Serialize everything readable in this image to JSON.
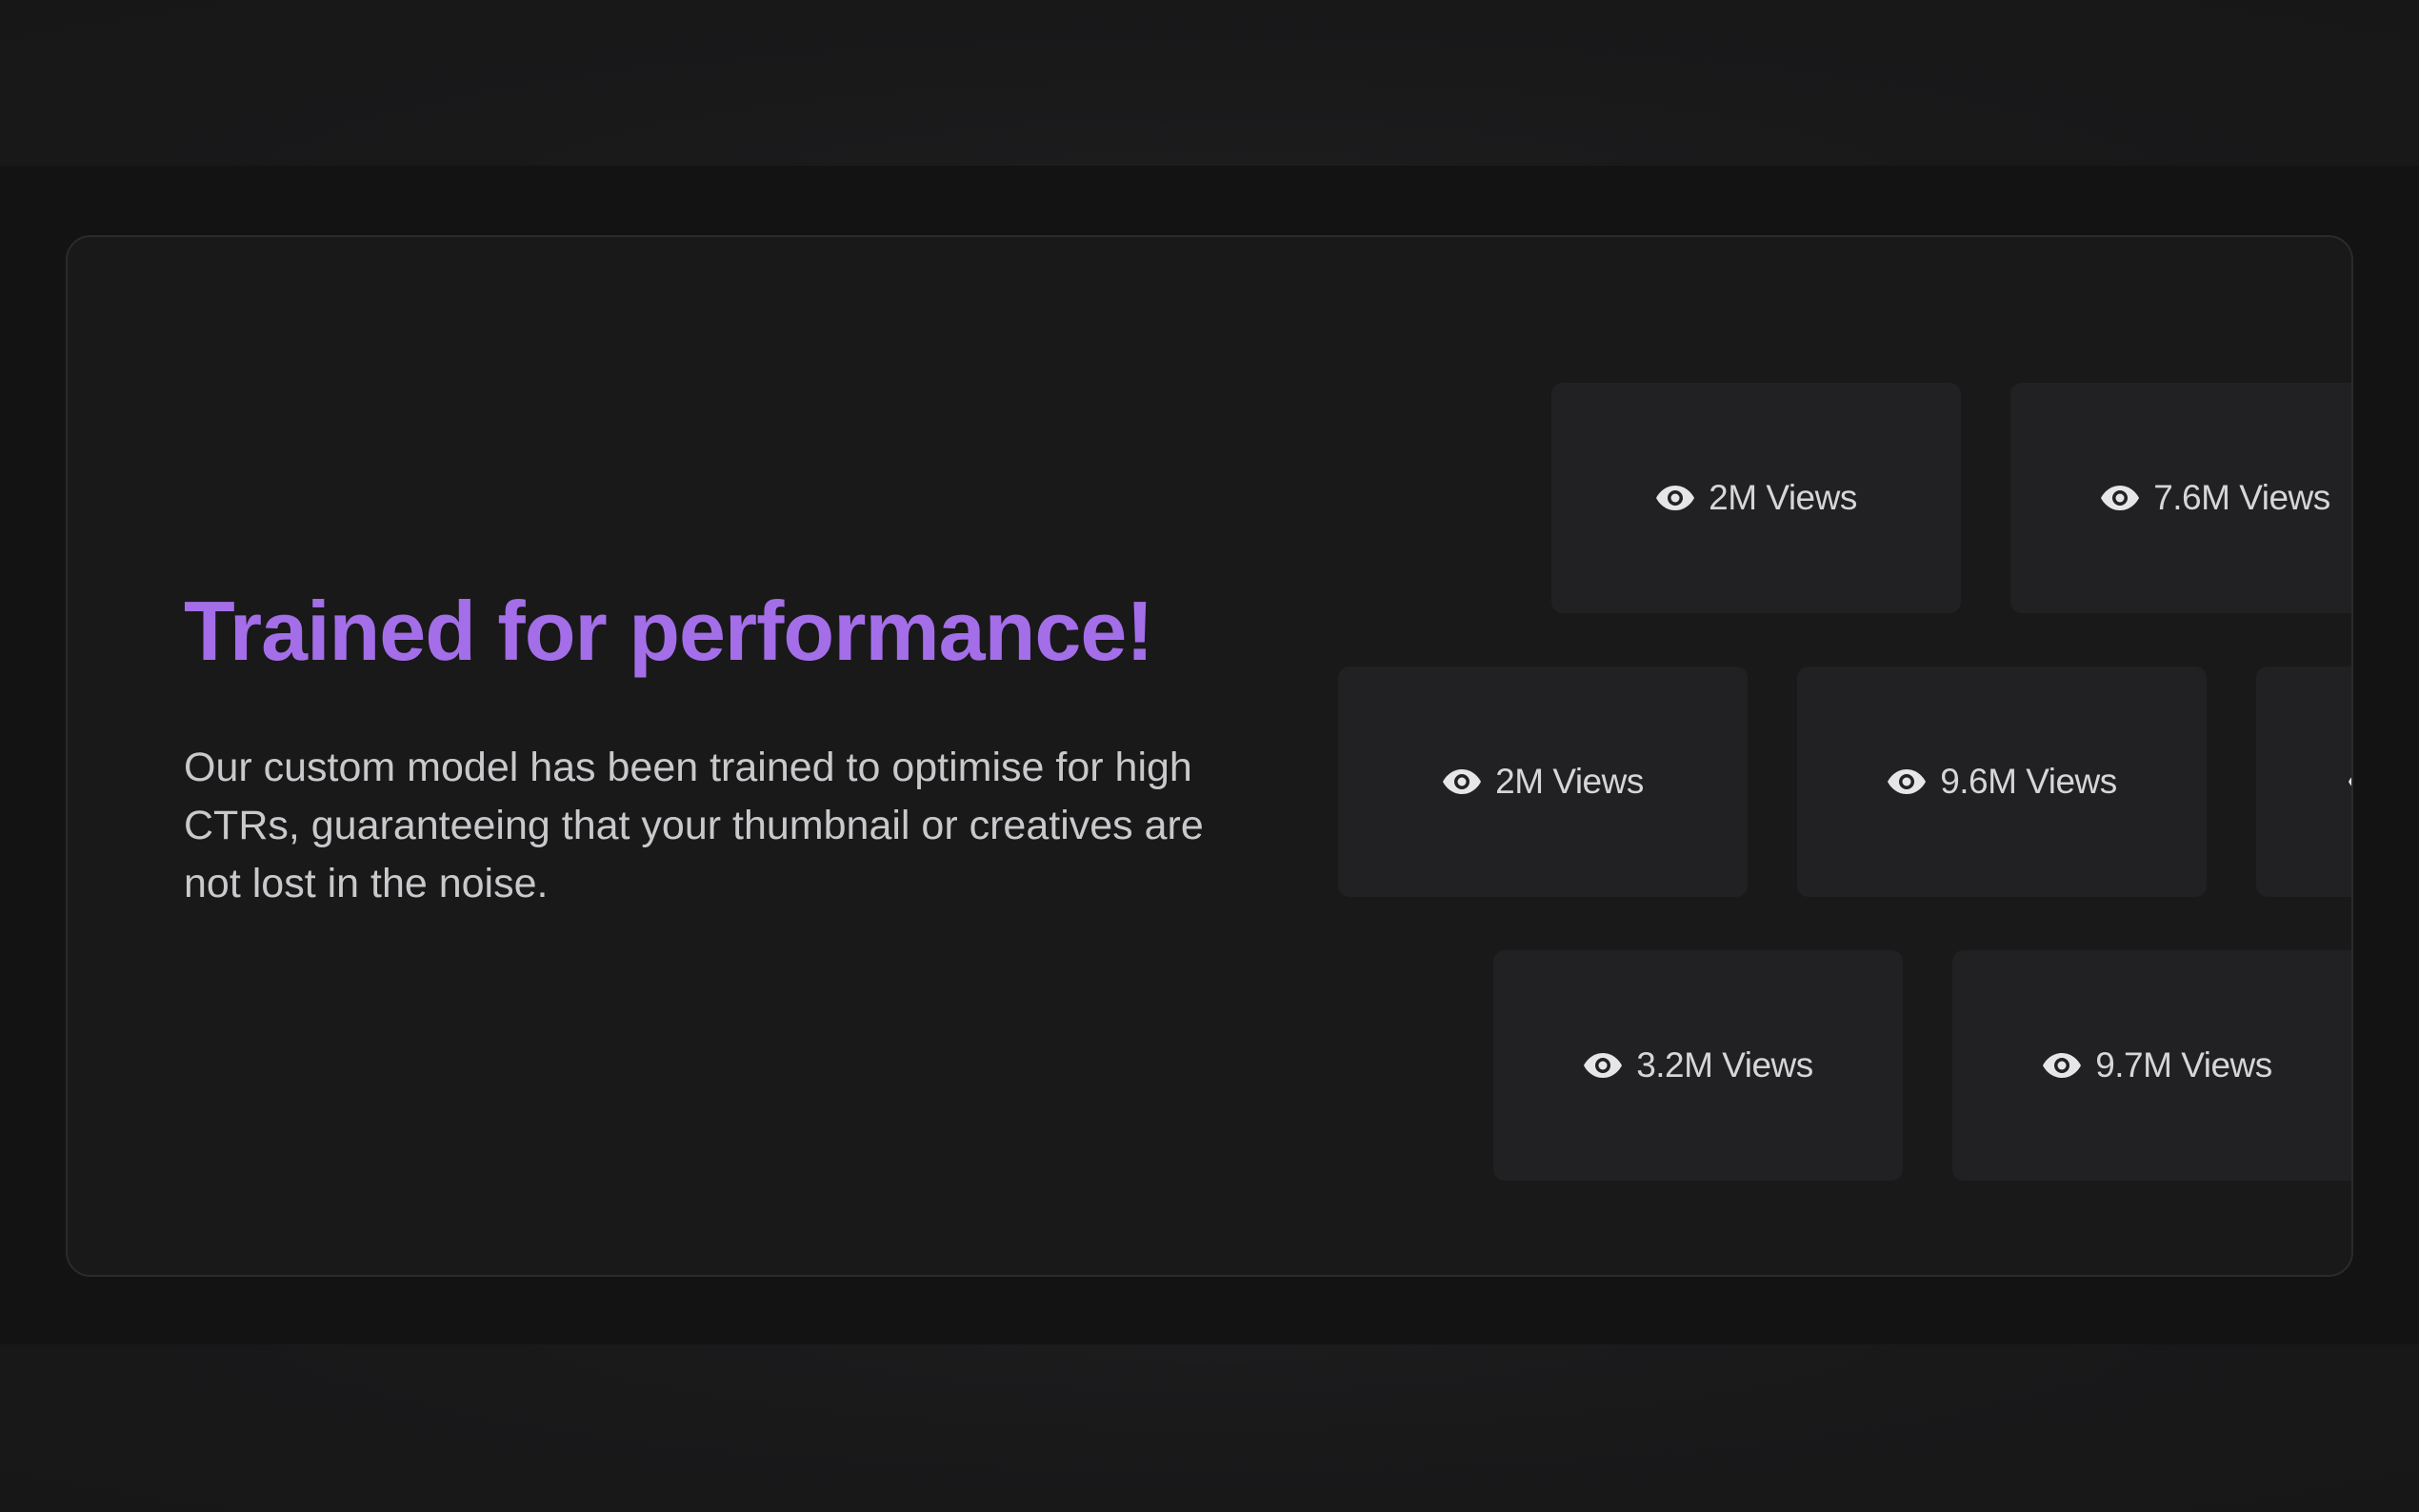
{
  "section": {
    "title": "Trained for performance!",
    "description": "Our custom model has been trained to optimise for high CTRs, guaranteeing that your thumbnail or creatives are not lost in the noise."
  },
  "colors": {
    "accent": "#a46ee9",
    "background": "#131314",
    "card": "#19191a",
    "tile": "#212123",
    "text": "#c9c9cc"
  },
  "tiles": [
    {
      "icon": "eye-icon",
      "label": "2M Views"
    },
    {
      "icon": "eye-icon",
      "label": "7.6M Views"
    },
    {
      "icon": "eye-icon",
      "label": "2M Views"
    },
    {
      "icon": "eye-icon",
      "label": "9.6M Views"
    },
    {
      "icon": "eye-icon",
      "label": ""
    },
    {
      "icon": "eye-icon",
      "label": "3.2M Views"
    },
    {
      "icon": "eye-icon",
      "label": "9.7M Views"
    }
  ]
}
